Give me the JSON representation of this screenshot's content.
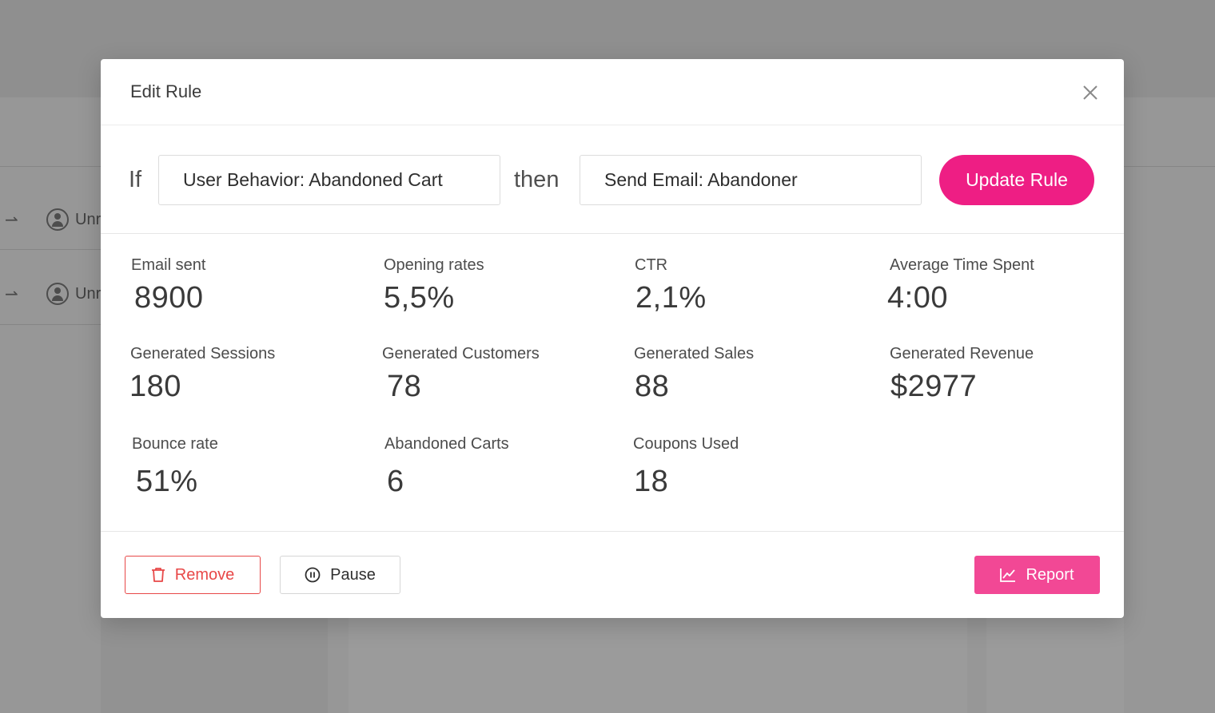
{
  "background": {
    "rows": [
      {
        "arrow": "⇀",
        "text": "Unr"
      },
      {
        "arrow": "⇀",
        "text": "Unr"
      }
    ]
  },
  "modal": {
    "title": "Edit Rule",
    "close_icon": "close-icon",
    "rule": {
      "if_label": "If",
      "condition_value": "User Behavior: Abandoned Cart",
      "then_label": "then",
      "action_value": "Send Email: Abandoner",
      "update_button": "Update Rule"
    },
    "stats": [
      {
        "label": "Email sent",
        "value": "8900"
      },
      {
        "label": "Opening rates",
        "value": "5,5%"
      },
      {
        "label": "CTR",
        "value": "2,1%"
      },
      {
        "label": "Average Time Spent",
        "value": "4:00"
      },
      {
        "label": "Generated Sessions",
        "value": "180"
      },
      {
        "label": "Generated Customers",
        "value": "78"
      },
      {
        "label": "Generated Sales",
        "value": "88"
      },
      {
        "label": "Generated Revenue",
        "value": "$2977"
      },
      {
        "label": "Bounce rate",
        "value": "51%"
      },
      {
        "label": "Abandoned Carts",
        "value": "6"
      },
      {
        "label": "Coupons Used",
        "value": "18"
      }
    ],
    "footer": {
      "remove_label": "Remove",
      "remove_icon": "trash-icon",
      "pause_label": "Pause",
      "pause_icon": "pause-circle-icon",
      "report_label": "Report",
      "report_icon": "line-chart-icon"
    }
  },
  "colors": {
    "accent": "#ee1e84",
    "report": "#f24895",
    "danger": "#e84848",
    "overlay": "#979797"
  }
}
